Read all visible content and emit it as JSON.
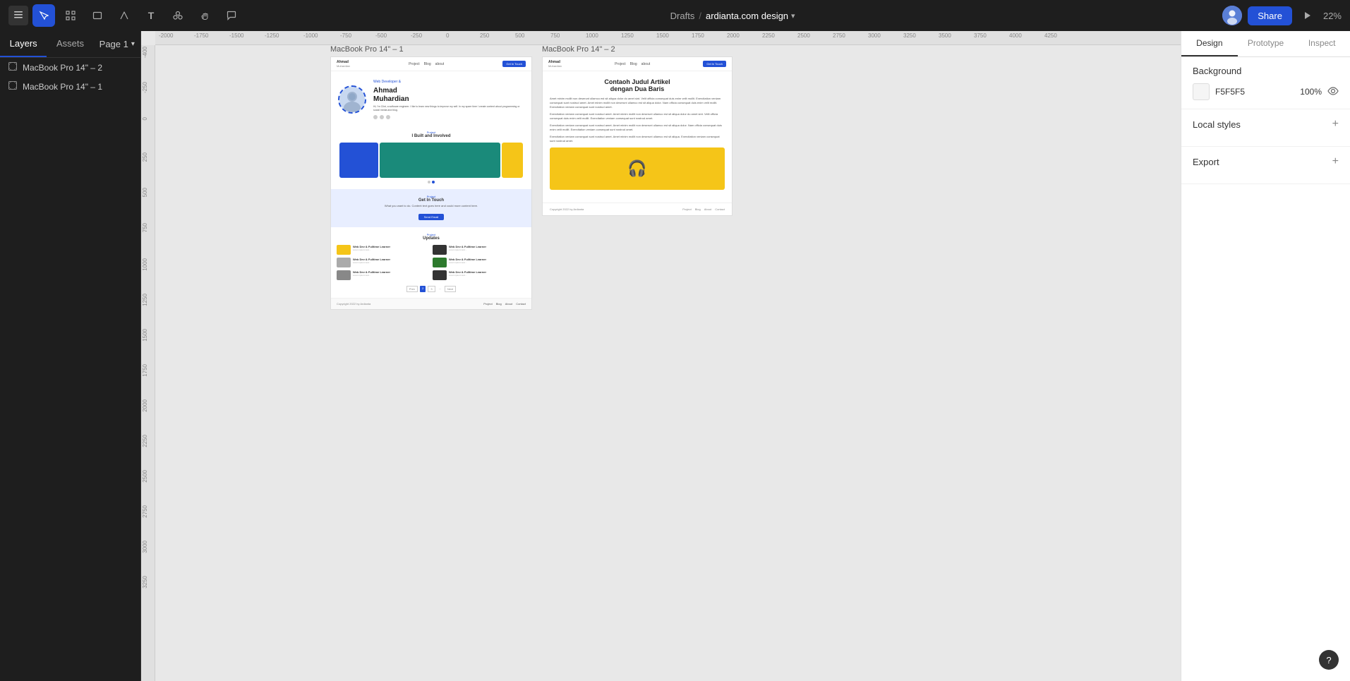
{
  "toolbar": {
    "menu_icon": "☰",
    "tools": [
      {
        "name": "select",
        "icon": "↖",
        "active": true
      },
      {
        "name": "frame",
        "icon": "⊞",
        "active": false
      },
      {
        "name": "rectangle",
        "icon": "□",
        "active": false
      },
      {
        "name": "vector",
        "icon": "◇",
        "active": false
      },
      {
        "name": "text",
        "icon": "T",
        "active": false
      },
      {
        "name": "components",
        "icon": "⊕",
        "active": false
      },
      {
        "name": "hand",
        "icon": "✋",
        "active": false
      },
      {
        "name": "comment",
        "icon": "💬",
        "active": false
      }
    ],
    "breadcrumb": {
      "drafts": "Drafts",
      "separator": "/",
      "filename": "ardianta.com design",
      "chevron": "▾"
    },
    "share_label": "Share",
    "play_icon": "▶",
    "zoom_level": "22%"
  },
  "left_panel": {
    "tabs": [
      {
        "id": "layers",
        "label": "Layers",
        "active": true
      },
      {
        "id": "assets",
        "label": "Assets",
        "active": false
      }
    ],
    "page_selector": {
      "label": "Page 1",
      "chevron": "▾"
    },
    "layers": [
      {
        "id": "layer1",
        "label": "MacBook Pro 14\" – 2",
        "icon": "⊞"
      },
      {
        "id": "layer2",
        "label": "MacBook Pro 14\" – 1",
        "icon": "⊞"
      }
    ]
  },
  "canvas": {
    "frame1": {
      "label": "MacBook Pro 14\" – 1",
      "nav": {
        "logo_name": "Ahmad",
        "logo_sub": "Muhardian",
        "links": [
          "Project",
          "Blog",
          "about"
        ],
        "cta": "Get In Touch"
      },
      "hero": {
        "name": "Ahmad Muhardian",
        "role": "Web Developer &",
        "bio": "Hi, I'm Clint, a software engineer. I like to learn new things to improve my self. In my spare time I create content about programming or social media and blog.",
        "social_dots": 3
      },
      "projects": {
        "label": "Project",
        "title": "I Built and Involved",
        "cards": [
          "blue",
          "teal",
          "yellow"
        ]
      },
      "contact": {
        "label": "Project",
        "title": "Get In Touch",
        "subtitle": "What you want to do. Content text goes here and could more content here.",
        "cta": "Send Email"
      },
      "updates": {
        "label": "Project",
        "title": "Updates",
        "items": [
          {
            "title": "Web Dev & Fulltime Learner",
            "thumb": "yellow"
          },
          {
            "title": "Web Dev & Fulltime Learner",
            "thumb": "dark"
          },
          {
            "title": "Web Dev & Fulltime Learner",
            "thumb": "white"
          },
          {
            "title": "Web Dev & Fulltime Learner",
            "thumb": "green"
          },
          {
            "title": "Web Dev & Fulltime Learner",
            "thumb": "gray"
          },
          {
            "title": "Web Dev & Fulltime Learner",
            "thumb": "dark2"
          }
        ]
      },
      "footer": {
        "copyright": "Copyright 2022 by Ardianta",
        "links": [
          "Project",
          "Blog",
          "About",
          "Contact"
        ]
      }
    },
    "frame2": {
      "label": "MacBook Pro 14\" – 2",
      "nav": {
        "logo_name": "Ahmad",
        "logo_sub": "Muhardian",
        "links": [
          "Project",
          "Blog",
          "about"
        ],
        "cta": "Get In Touch"
      },
      "article": {
        "title": "Contaoh Judul Artikel dengan Dua Baris",
        "paragraphs": [
          "Amet minim mollit non deserunt ullamco est sit aliqua dolor do amet sint. Velit officia consequat duis enim velit mollit. Exercitation veniam consequat sunt nostrud amet.",
          "Exercitation veniam consequat sunt nostrud amet. Amet minim mollit non deserunt ullamco est sit aliqua dolor do amet sint. Velit officia consequat duis enim velit mollit.",
          "Exercitation veniam consequat sunt nostrud amet. Amet minim mollit non deserunt ullamco est sit aliqua dolor do amet sint. Velit officia consequat duis enim velit mollit. Exercitation veniam consequat sunt nostrud amet.",
          "Exercitation veniam consequat sunt nostrud amet. Amet minim mollit non deserunt ullamco est sit aliqua dolor. Exercitation veniam consequat sunt nostrud amet."
        ],
        "image_icon": "🎧"
      },
      "footer": {
        "copyright": "Copyright 2022 by Ardianta",
        "links": [
          "Project",
          "Blog",
          "About",
          "Contact"
        ]
      }
    }
  },
  "right_panel": {
    "tabs": [
      {
        "id": "design",
        "label": "Design",
        "active": true
      },
      {
        "id": "prototype",
        "label": "Prototype",
        "active": false
      },
      {
        "id": "inspect",
        "label": "Inspect",
        "active": false
      }
    ],
    "background": {
      "section_title": "Background",
      "color_value": "F5F5F5",
      "opacity": "100%",
      "eye_icon": "👁"
    },
    "local_styles": {
      "section_title": "Local styles",
      "add_icon": "+"
    },
    "export": {
      "section_title": "Export",
      "add_icon": "+"
    }
  },
  "help": {
    "label": "?"
  }
}
